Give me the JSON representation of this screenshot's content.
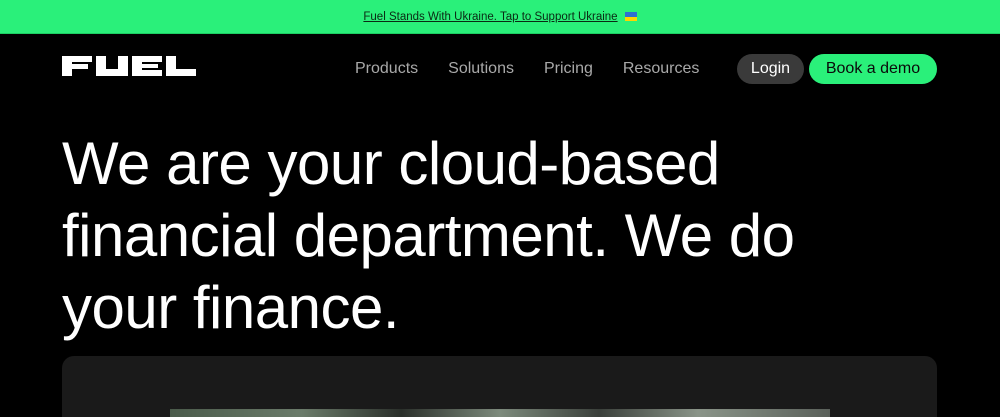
{
  "banner": {
    "text": "Fuel Stands With Ukraine. Tap to Support Ukraine",
    "flag_icon": "ukraine-flag-icon"
  },
  "nav": {
    "logo_text": "FUEL",
    "links": [
      "Products",
      "Solutions",
      "Pricing",
      "Resources"
    ],
    "login_label": "Login",
    "demo_label": "Book a demo"
  },
  "hero": {
    "title": "We are your cloud-based financial department. We do your finance."
  },
  "colors": {
    "accent": "#2af07a",
    "background": "#000000",
    "nav_link": "#a9a9a9",
    "login_bg": "#3a3a3a"
  }
}
